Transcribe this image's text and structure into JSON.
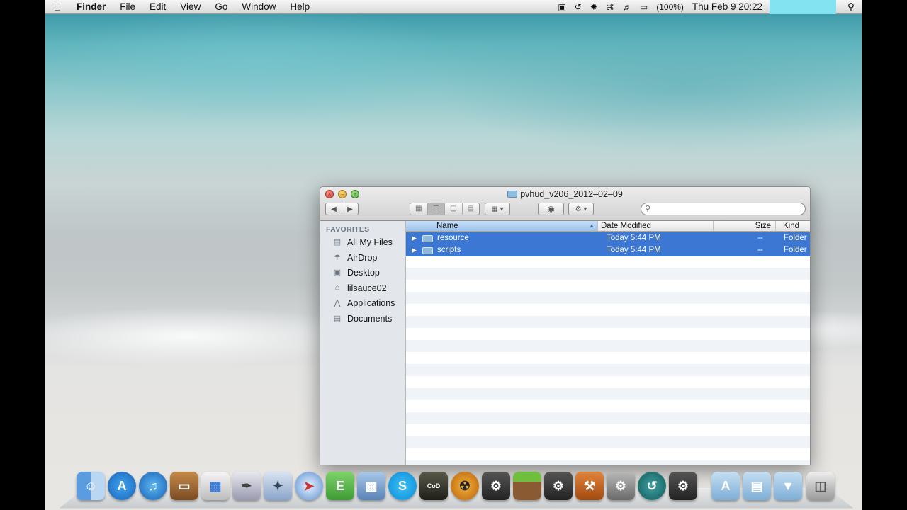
{
  "menubar": {
    "apple": "",
    "app": "Finder",
    "items": [
      "File",
      "Edit",
      "View",
      "Go",
      "Window",
      "Help"
    ],
    "battery": "(100%)",
    "clock": "Thu Feb 9  20:22"
  },
  "window": {
    "title": "pvhud_v206_2012–02–09",
    "sidebar": {
      "header": "FAVORITES",
      "items": [
        {
          "label": "All My Files",
          "icon": "all-files-icon"
        },
        {
          "label": "AirDrop",
          "icon": "airdrop-icon"
        },
        {
          "label": "Desktop",
          "icon": "desktop-icon"
        },
        {
          "label": "lilsauce02",
          "icon": "home-icon"
        },
        {
          "label": "Applications",
          "icon": "applications-icon"
        },
        {
          "label": "Documents",
          "icon": "documents-icon"
        }
      ]
    },
    "columns": {
      "name": "Name",
      "date": "Date Modified",
      "size": "Size",
      "kind": "Kind"
    },
    "rows": [
      {
        "name": "resource",
        "date": "Today 5:44 PM",
        "size": "--",
        "kind": "Folder"
      },
      {
        "name": "scripts",
        "date": "Today 5:44 PM",
        "size": "--",
        "kind": "Folder"
      }
    ]
  },
  "dock": {
    "icons": [
      "finder-icon",
      "app-store-icon",
      "itunes-icon",
      "keynote-icon",
      "numbers-icon",
      "pages-icon",
      "preview-icon",
      "safari-icon",
      "evernote-icon",
      "iphoto-icon",
      "skype-icon",
      "call-of-duty-icon",
      "radioactive-icon",
      "steam-icon",
      "minecraft-icon",
      "steam-icon-2",
      "game-icon",
      "system-preferences-icon",
      "time-machine-icon",
      "steam-icon-3",
      "applications-stack-icon",
      "documents-stack-icon",
      "downloads-stack-icon",
      "trash-icon"
    ]
  },
  "colors": {
    "selection": "#3b77d3",
    "menubar": "#e6e6e6",
    "sidebar": "#e3e7ec"
  }
}
